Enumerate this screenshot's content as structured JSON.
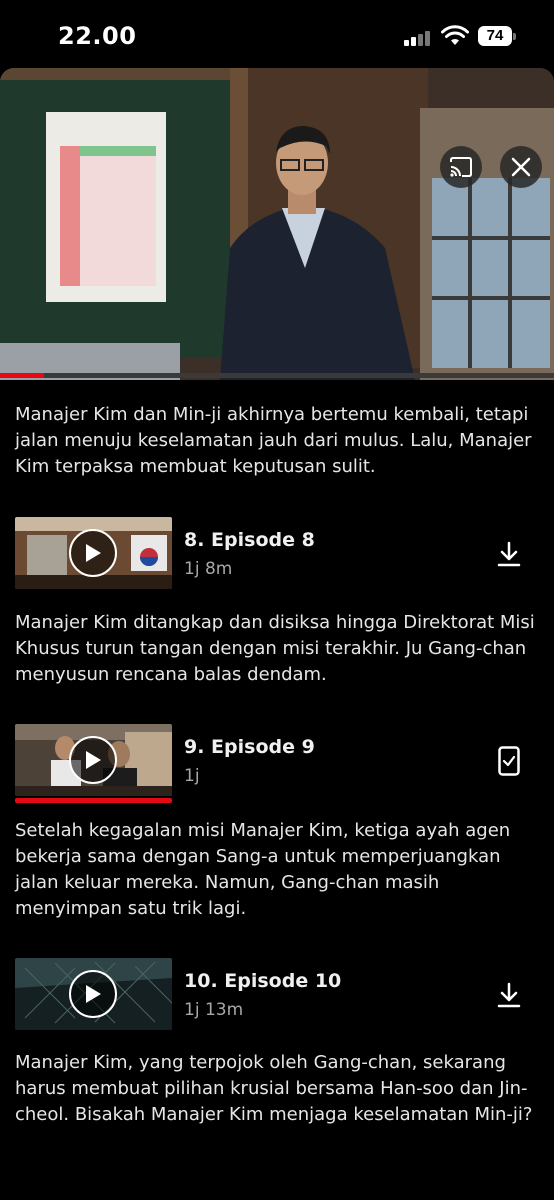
{
  "status_bar": {
    "time": "22.00",
    "battery": "74"
  },
  "player": {
    "progress": 0.08,
    "cast_icon": "cast-icon",
    "close_icon": "close-icon",
    "mute_icon": "muted-speaker-icon"
  },
  "previous_description": "Manajer Kim dan Min-ji akhirnya bertemu kembali, tetapi jalan menuju keselamatan jauh dari mulus. Lalu, Manajer Kim terpaksa membuat keputusan sulit.",
  "episodes": [
    {
      "title": "8. Episode 8",
      "duration": "1j 8m",
      "action": "download-icon",
      "watched": 0,
      "description": "Manajer Kim ditangkap dan disiksa hingga Direktorat Misi Khusus turun tangan dengan misi terakhir. Ju Gang-chan menyusun rencana balas dendam."
    },
    {
      "title": "9. Episode 9",
      "duration": "1j",
      "action": "downloaded-device-icon",
      "watched": 1,
      "description": "Setelah kegagalan misi Manajer Kim, ketiga ayah agen bekerja sama dengan Sang-a untuk memperjuangkan jalan keluar mereka. Namun, Gang-chan masih menyimpan satu trik lagi."
    },
    {
      "title": "10. Episode 10",
      "duration": "1j 13m",
      "action": "download-icon",
      "watched": 0,
      "description": "Manajer Kim, yang terpojok oleh Gang-chan, sekarang harus membuat pilihan krusial bersama Han-soo dan Jin-cheol. Bisakah Manajer Kim menjaga keselamatan Min-ji?"
    }
  ],
  "colors": {
    "accent": "#e50914",
    "background": "#000000",
    "text": "#e6e6e6",
    "muted": "#a8a8a8"
  }
}
